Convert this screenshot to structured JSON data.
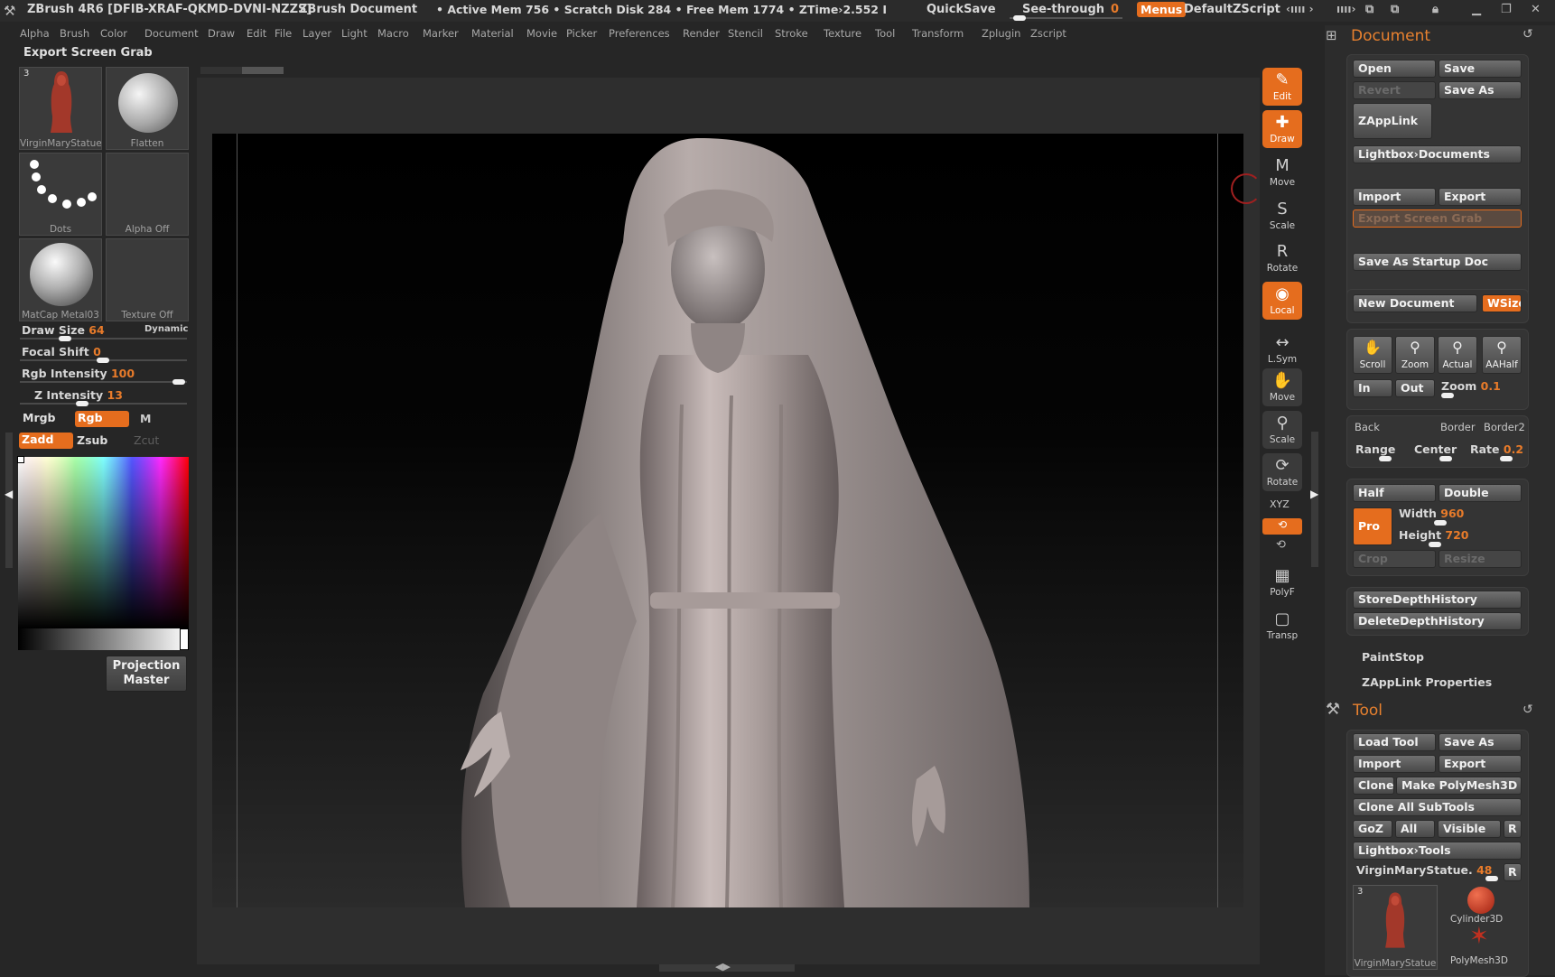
{
  "titlebar": {
    "app": "ZBrush 4R6 [DFIB-XRAF-QKMD-DVNI-NZZS]",
    "doc": "ZBrush Document",
    "mem": "• Active Mem 756 • Scratch Disk 284 • Free Mem 1774 • ZTime›2.552 I",
    "quicksave": "QuickSave",
    "seethrough": "See-through",
    "seethrough_val": "0",
    "menus": "Menus",
    "script": "DefaultZScript"
  },
  "menubar": [
    "Alpha",
    "Brush",
    "Color",
    "Document",
    "Draw",
    "Edit",
    "File",
    "Layer",
    "Light",
    "Macro",
    "Marker",
    "Material",
    "Movie",
    "Picker",
    "Preferences",
    "Render",
    "Stencil",
    "Stroke",
    "Texture",
    "Tool",
    "Transform",
    "Zplugin",
    "Zscript"
  ],
  "left": {
    "header": "Export Screen Grab",
    "thumbs": [
      {
        "caption": "VirginMaryStatue",
        "badge": "3"
      },
      {
        "caption": "Flatten"
      },
      {
        "caption": "Dots"
      },
      {
        "caption": "Alpha  Off"
      },
      {
        "caption": "MatCap Metal03"
      },
      {
        "caption": "Texture  Off"
      }
    ],
    "draw_size_label": "Draw Size",
    "draw_size_val": "64",
    "dynamic": "Dynamic",
    "focal_label": "Focal Shift",
    "focal_val": "0",
    "rgb_int_label": "Rgb Intensity",
    "rgb_int_val": "100",
    "z_int_label": "Z Intensity",
    "z_int_val": "13",
    "mrgb": "Mrgb",
    "rgb": "Rgb",
    "m": "M",
    "zadd": "Zadd",
    "zsub": "Zsub",
    "zcut": "Zcut",
    "projection_master": [
      "Projection",
      "Master"
    ]
  },
  "shelf": [
    {
      "label": "Edit",
      "icon": "✎"
    },
    {
      "label": "Draw",
      "icon": "✚"
    },
    {
      "label": "Move",
      "icon": "M"
    },
    {
      "label": "Scale",
      "icon": "S"
    },
    {
      "label": "Rotate",
      "icon": "R"
    },
    {
      "label": "Local",
      "icon": "◉"
    },
    {
      "label": "L.Sym",
      "icon": "↔"
    },
    {
      "label": "Move",
      "icon": "✋"
    },
    {
      "label": "Scale",
      "icon": "⚲"
    },
    {
      "label": "Rotate",
      "icon": "⟳"
    },
    {
      "label": "PolyF",
      "icon": "▦"
    },
    {
      "label": "Transp",
      "icon": "▢"
    }
  ],
  "shelf_xyz": "XYZ",
  "document": {
    "title": "Document",
    "open": "Open",
    "save": "Save",
    "revert": "Revert",
    "save_as": "Save As",
    "zapplink": "ZAppLink",
    "lightbox": "Lightbox›Documents",
    "import": "Import",
    "export": "Export",
    "export_screen_grab": "Export Screen Grab",
    "save_startup": "Save As Startup Doc",
    "new_document": "New Document",
    "wsize": "WSize",
    "scroll": "Scroll",
    "zoom": "Zoom",
    "actual": "Actual",
    "aahalf": "AAHalf",
    "in": "In",
    "out": "Out",
    "zoom_label": "Zoom",
    "zoom_val": "0.1",
    "back": "Back",
    "border": "Border",
    "border2": "Border2",
    "range": "Range",
    "center": "Center",
    "rate": "Rate",
    "rate_val": "0.2",
    "half": "Half",
    "double": "Double",
    "pro": "Pro",
    "width_label": "Width",
    "width_val": "960",
    "height_label": "Height",
    "height_val": "720",
    "crop": "Crop",
    "resize": "Resize",
    "store_depth": "StoreDepthHistory",
    "delete_depth": "DeleteDepthHistory",
    "paintstop": "PaintStop",
    "zapplink_props": "ZAppLink Properties"
  },
  "tool": {
    "title": "Tool",
    "load_tool": "Load Tool",
    "save_as": "Save As",
    "import": "Import",
    "export": "Export",
    "clone": "Clone",
    "make_polymesh": "Make PolyMesh3D",
    "clone_all": "Clone All SubTools",
    "goz": "GoZ",
    "all": "All",
    "visible": "Visible",
    "r": "R",
    "lightbox_tools": "Lightbox›Tools",
    "current_tool": "VirginMaryStatue.",
    "current_val": "48",
    "thumb_main": "VirginMaryStatue",
    "thumb_badge": "3",
    "cylinder": "Cylinder3D",
    "polymesh": "PolyMesh3D"
  },
  "colors": {
    "accent": "#e56d1e",
    "panel": "#343434",
    "bg": "#262626"
  }
}
